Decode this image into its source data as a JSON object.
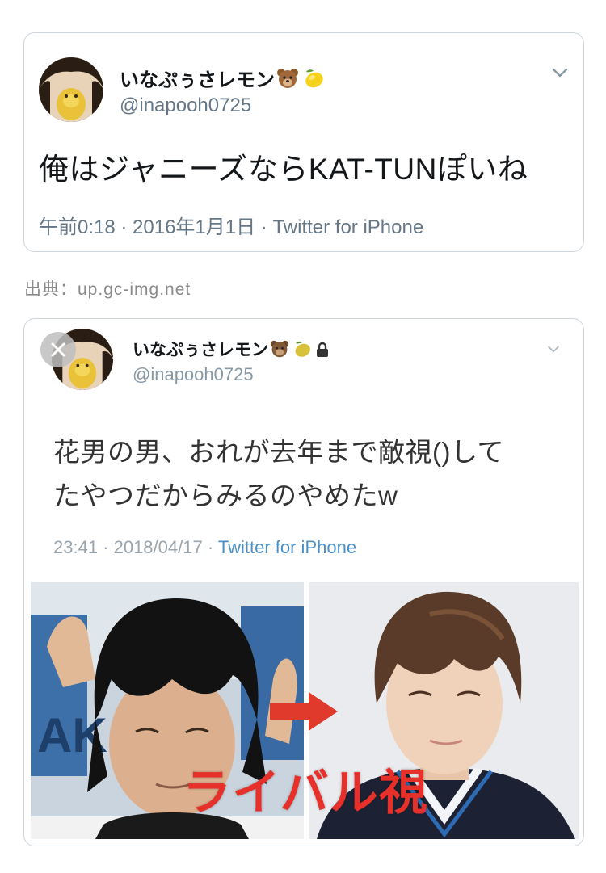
{
  "tweet1": {
    "display_name": "いなぷぅさレモン",
    "name_emojis": [
      "bear-face-emoji",
      "lemon-emoji"
    ],
    "handle": "@inapooh0725",
    "text": "俺はジャニーズならKAT-TUNぽいね",
    "meta": "午前0:18 · 2016年1月1日 · Twitter for iPhone",
    "menu_icon": "chevron-down-icon"
  },
  "source": {
    "label": "出典：up.gc-img.net"
  },
  "tweet2": {
    "display_name": "いなぷぅさレモン",
    "name_emojis": [
      "bear-face-emoji",
      "lemon-emoji",
      "lock-icon"
    ],
    "handle": "@inapooh0725",
    "text_line1": "花男の男、おれが去年まで敵視()して",
    "text_line2": "たやつだからみるのやめたw",
    "meta_time": "23:41 · 2018/04/17 · ",
    "meta_via": "Twitter for iPhone",
    "menu_icon": "chevron-down-icon",
    "close_icon": "close-icon",
    "photo_caption": "ライバル視",
    "arrow_icon": "right-arrow-icon"
  },
  "colors": {
    "text": "#14171a",
    "secondary": "#657786",
    "border": "#cfd6db",
    "link": "#4a90c8",
    "caption": "#e8302a"
  }
}
